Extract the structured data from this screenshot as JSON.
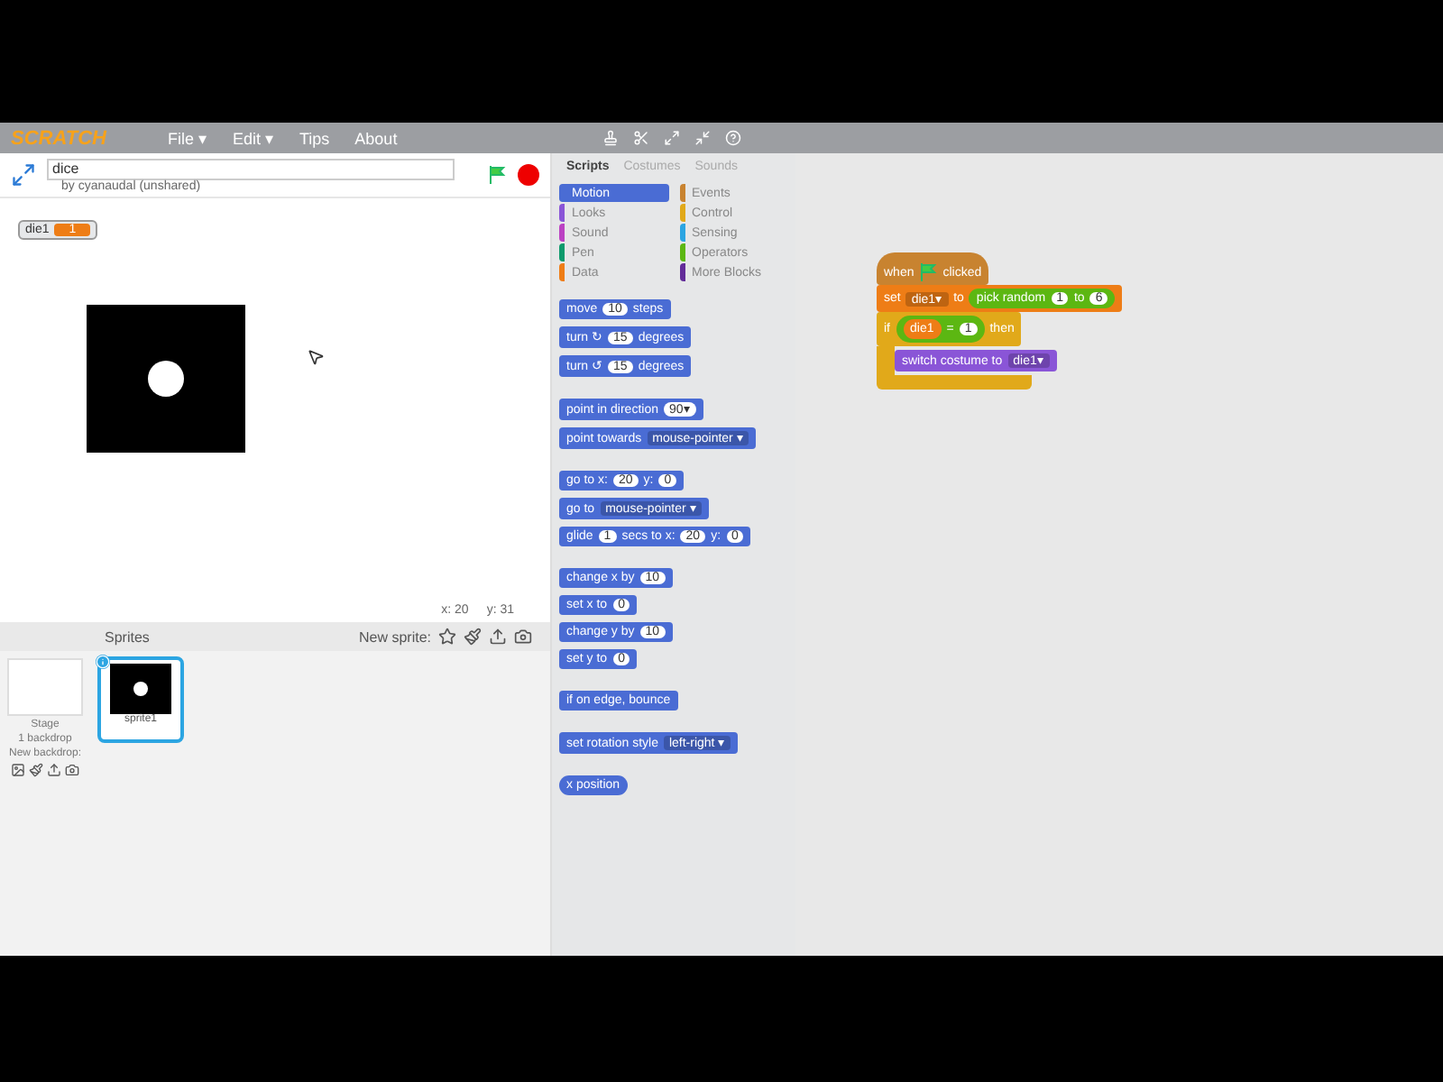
{
  "menubar": {
    "logo": "SCRATCH",
    "menus": [
      "File ▾",
      "Edit ▾",
      "Tips",
      "About"
    ]
  },
  "project": {
    "title": "dice",
    "author": "by cyanaudal (unshared)"
  },
  "stage": {
    "monitor": {
      "label": "die1",
      "value": "1"
    },
    "mouse_x": "x: 20",
    "mouse_y": "y: 31"
  },
  "sprites_pane": {
    "label": "Sprites",
    "new_sprite": "New sprite:",
    "stage_label": "Stage",
    "stage_sub": "1 backdrop",
    "new_backdrop": "New backdrop:",
    "sprites": [
      {
        "name": "sprite1",
        "selected": true
      }
    ]
  },
  "tabs": [
    {
      "label": "Scripts",
      "selected": true
    },
    {
      "label": "Costumes",
      "selected": false
    },
    {
      "label": "Sounds",
      "selected": false
    }
  ],
  "categories": [
    {
      "label": "Motion",
      "color": "#4a6cd4",
      "selected": true
    },
    {
      "label": "Events",
      "color": "#c88330",
      "selected": false
    },
    {
      "label": "Looks",
      "color": "#8a55d7",
      "selected": false
    },
    {
      "label": "Control",
      "color": "#e1a91a",
      "selected": false
    },
    {
      "label": "Sound",
      "color": "#bb42c3",
      "selected": false
    },
    {
      "label": "Sensing",
      "color": "#2ca5e2",
      "selected": false
    },
    {
      "label": "Pen",
      "color": "#0e9a6c",
      "selected": false
    },
    {
      "label": "Operators",
      "color": "#5cb712",
      "selected": false
    },
    {
      "label": "Data",
      "color": "#ee7d16",
      "selected": false
    },
    {
      "label": "More Blocks",
      "color": "#632d99",
      "selected": false
    }
  ],
  "palette": [
    [
      [
        {
          "kind": "text",
          "text": "move"
        },
        {
          "kind": "number",
          "text": "10"
        },
        {
          "kind": "text",
          "text": "steps"
        }
      ],
      [
        {
          "kind": "text",
          "text": "turn ↻"
        },
        {
          "kind": "number",
          "text": "15"
        },
        {
          "kind": "text",
          "text": "degrees"
        }
      ],
      [
        {
          "kind": "text",
          "text": "turn ↺"
        },
        {
          "kind": "number",
          "text": "15"
        },
        {
          "kind": "text",
          "text": "degrees"
        }
      ]
    ],
    [
      [
        {
          "kind": "text",
          "text": "point in direction"
        },
        {
          "kind": "number",
          "text": "90▾"
        }
      ],
      [
        {
          "kind": "text",
          "text": "point towards"
        },
        {
          "kind": "dropdown",
          "text": "mouse-pointer ▾"
        }
      ]
    ],
    [
      [
        {
          "kind": "text",
          "text": "go to x:"
        },
        {
          "kind": "number",
          "text": "20"
        },
        {
          "kind": "text",
          "text": "y:"
        },
        {
          "kind": "number",
          "text": "0"
        }
      ],
      [
        {
          "kind": "text",
          "text": "go to"
        },
        {
          "kind": "dropdown",
          "text": "mouse-pointer ▾"
        }
      ],
      [
        {
          "kind": "text",
          "text": "glide"
        },
        {
          "kind": "number",
          "text": "1"
        },
        {
          "kind": "text",
          "text": "secs to x:"
        },
        {
          "kind": "number",
          "text": "20"
        },
        {
          "kind": "text",
          "text": "y:"
        },
        {
          "kind": "number",
          "text": "0"
        }
      ]
    ],
    [
      [
        {
          "kind": "text",
          "text": "change x by"
        },
        {
          "kind": "number",
          "text": "10"
        }
      ],
      [
        {
          "kind": "text",
          "text": "set x to"
        },
        {
          "kind": "number",
          "text": "0"
        }
      ],
      [
        {
          "kind": "text",
          "text": "change y by"
        },
        {
          "kind": "number",
          "text": "10"
        }
      ],
      [
        {
          "kind": "text",
          "text": "set y to"
        },
        {
          "kind": "number",
          "text": "0"
        }
      ]
    ],
    [
      [
        {
          "kind": "text",
          "text": "if on edge, bounce"
        }
      ]
    ],
    [
      [
        {
          "kind": "text",
          "text": "set rotation style"
        },
        {
          "kind": "dropdown",
          "text": "left-right ▾"
        }
      ]
    ],
    [
      [
        {
          "kind": "reporter",
          "color": "#4a6cd4",
          "parts": [
            {
              "kind": "text",
              "text": "x position"
            }
          ]
        }
      ]
    ]
  ],
  "script": [
    {
      "kind": "hat",
      "color": "#c88330",
      "parts": [
        {
          "kind": "text",
          "text": "when"
        },
        {
          "kind": "flag"
        },
        {
          "kind": "text",
          "text": "clicked"
        }
      ]
    },
    {
      "kind": "stack",
      "color": "#ee7d16",
      "parts": [
        {
          "kind": "text",
          "text": "set"
        },
        {
          "kind": "dropdown",
          "text": "die1▾"
        },
        {
          "kind": "text",
          "text": "to"
        },
        {
          "kind": "reporter",
          "color": "#5cb712",
          "parts": [
            {
              "kind": "text",
              "text": "pick random"
            },
            {
              "kind": "number",
              "text": "1"
            },
            {
              "kind": "text",
              "text": "to"
            },
            {
              "kind": "number",
              "text": "6"
            }
          ]
        }
      ]
    },
    {
      "kind": "c",
      "color": "#e1a91a",
      "parts": [
        {
          "kind": "text",
          "text": "if"
        },
        {
          "kind": "reporter",
          "color": "#5cb712",
          "parts": [
            {
              "kind": "reporter",
              "color": "#ee7d16",
              "parts": [
                {
                  "kind": "text",
                  "text": "die1"
                }
              ]
            },
            {
              "kind": "text",
              "text": "="
            },
            {
              "kind": "number",
              "text": "1"
            }
          ]
        },
        {
          "kind": "text",
          "text": "then"
        }
      ],
      "children": [
        {
          "kind": "stack",
          "color": "#8a55d7",
          "parts": [
            {
              "kind": "text",
              "text": "switch costume to"
            },
            {
              "kind": "dropdown",
              "text": "die1▾"
            }
          ]
        }
      ]
    }
  ]
}
